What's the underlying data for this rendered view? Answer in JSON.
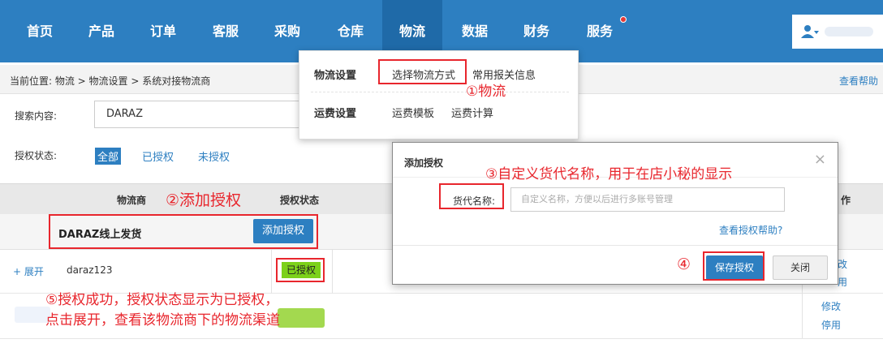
{
  "nav": {
    "items": [
      "首页",
      "产品",
      "订单",
      "客服",
      "采购",
      "仓库",
      "物流",
      "数据",
      "财务",
      "服务"
    ],
    "active": "物流"
  },
  "breadcrumb": {
    "text": "当前位置:  物流 > 物流设置 > 系统对接物流商",
    "help": "查看帮助"
  },
  "search": {
    "label": "搜索内容:",
    "value": "DARAZ"
  },
  "auth_filter": {
    "label": "授权状态:",
    "options": [
      "全部",
      "已授权",
      "未授权"
    ],
    "selected": "全部"
  },
  "table": {
    "headers": {
      "carrier": "物流商",
      "status": "授权状态",
      "op": "作"
    },
    "group": {
      "name": "DARAZ线上发货",
      "add_button": "添加授权"
    },
    "rows": [
      {
        "expand": "+ 展开",
        "account": "daraz123",
        "status": "已授权",
        "actions": [
          "改",
          "用"
        ]
      },
      {
        "expand": "",
        "account": "",
        "status": "",
        "actions": [
          "修改",
          "停用"
        ]
      }
    ]
  },
  "dropdown": {
    "groups": [
      {
        "title": "物流设置",
        "items": [
          "选择物流方式",
          "常用报关信息"
        ]
      },
      {
        "title": "运费设置",
        "items": [
          "运费模板",
          "运费计算"
        ]
      }
    ]
  },
  "modal": {
    "title": "添加授权",
    "close": "×",
    "field_label": "货代名称:",
    "field_placeholder": "自定义名称，方便以后进行多账号管理",
    "help_link": "查看授权帮助?",
    "save": "保存授权",
    "cancel": "关闭"
  },
  "annotations": {
    "a1": "①物流",
    "a2": "②添加授权",
    "a3": "③自定义货代名称，用于在店小秘的显示",
    "a4": "④",
    "a5_line1": "⑤授权成功，授权状态显示为已授权，",
    "a5_line2": "点击展开，查看该物流商下的物流渠道"
  },
  "colors": {
    "primary": "#2d7fc1",
    "annotation": "#e8262d",
    "authorized": "#7cd11a"
  }
}
